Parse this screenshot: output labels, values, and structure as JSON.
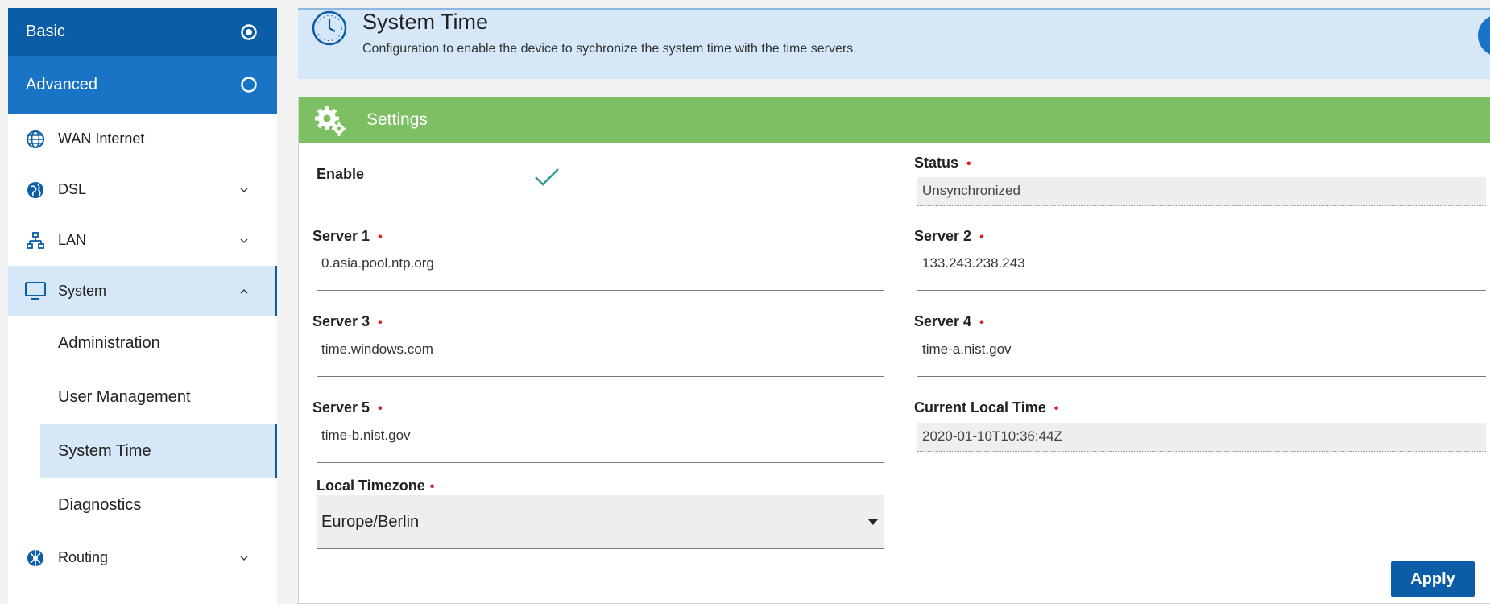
{
  "sidebar": {
    "basic_label": "Basic",
    "advanced_label": "Advanced",
    "items": [
      {
        "label": "WAN Internet"
      },
      {
        "label": "DSL"
      },
      {
        "label": "LAN"
      },
      {
        "label": "System"
      },
      {
        "label": "Routing"
      }
    ],
    "system_sub": [
      {
        "label": "Administration"
      },
      {
        "label": "User Management"
      },
      {
        "label": "System Time"
      },
      {
        "label": "Diagnostics"
      }
    ]
  },
  "header": {
    "title": "System Time",
    "description": "Configuration to enable the device to sychronize the system time with the time servers."
  },
  "card": {
    "title": "Settings",
    "enable_label": "Enable",
    "status_label": "Status",
    "status_value": "Unsynchronized",
    "server1_label": "Server 1",
    "server1_value": "0.asia.pool.ntp.org",
    "server2_label": "Server 2",
    "server2_value": "133.243.238.243",
    "server3_label": "Server 3",
    "server3_value": "time.windows.com",
    "server4_label": "Server 4",
    "server4_value": "time-a.nist.gov",
    "server5_label": "Server 5",
    "server5_value": "time-b.nist.gov",
    "local_time_label": "Current Local Time",
    "local_time_value": "2020-01-10T10:36:44Z",
    "timezone_label": "Local Timezone",
    "timezone_value": "Europe/Berlin",
    "apply_label": "Apply",
    "required_mark": "•"
  },
  "colors": {
    "primary": "#0a5da6",
    "header_bg": "#d6e8f8",
    "settings_green": "#7dbf63",
    "check_teal": "#2e9c8e",
    "required_red": "#e01b1b"
  }
}
